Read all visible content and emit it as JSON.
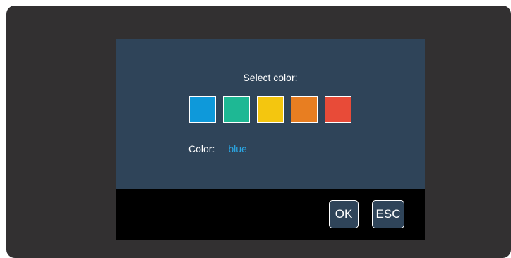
{
  "dialog": {
    "prompt": "Select color:",
    "swatches": [
      {
        "name": "blue",
        "color": "#0e99da"
      },
      {
        "name": "green",
        "color": "#1eb894"
      },
      {
        "name": "yellow",
        "color": "#f4c60f"
      },
      {
        "name": "orange",
        "color": "#e87e21"
      },
      {
        "name": "red",
        "color": "#e84b38"
      }
    ],
    "color_label": "Color:",
    "color_value": "blue",
    "color_value_color": "#2aa8e6"
  },
  "footer": {
    "ok_label": "OK",
    "esc_label": "ESC"
  }
}
